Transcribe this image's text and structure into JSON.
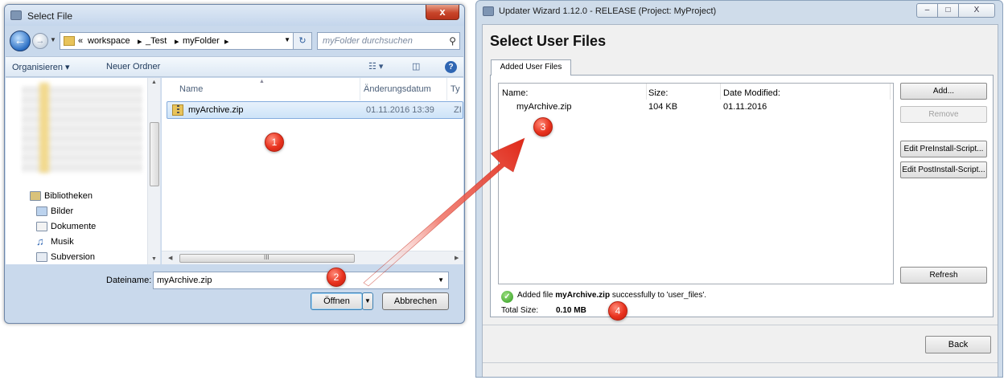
{
  "file_dialog": {
    "title": "Select File",
    "close_glyph": "x",
    "breadcrumb": [
      "«",
      "workspace",
      "▸",
      "_Test",
      "▸",
      "myFolder",
      "▸"
    ],
    "search_placeholder": "myFolder durchsuchen",
    "toolbar": {
      "organize": "Organisieren ▾",
      "new_folder": "Neuer Ordner"
    },
    "tree": [
      {
        "label": "Bibliotheken",
        "icon": "libraries-icon"
      },
      {
        "label": "Bilder",
        "icon": "pictures-icon"
      },
      {
        "label": "Dokumente",
        "icon": "documents-icon"
      },
      {
        "label": "Musik",
        "icon": "music-icon"
      },
      {
        "label": "Subversion",
        "icon": "subversion-icon"
      }
    ],
    "columns": {
      "name": "Name",
      "date": "Änderungsdatum",
      "type": "Ty"
    },
    "file": {
      "name": "myArchive.zip",
      "date": "01.11.2016 13:39",
      "type": "ZI"
    },
    "filename_label": "Dateiname:",
    "filename_value": "myArchive.zip",
    "open_label": "Öffnen",
    "cancel_label": "Abbrechen",
    "scroll_grip": "III"
  },
  "wizard": {
    "title": "Updater Wizard 1.12.0 - RELEASE (Project: MyProject)",
    "window_buttons": {
      "min": "–",
      "max": "□",
      "close": "X"
    },
    "heading": "Select User Files",
    "tab": "Added User Files",
    "columns": {
      "name": "Name:",
      "size": "Size:",
      "date": "Date Modified:"
    },
    "row": {
      "name": "myArchive.zip",
      "size": "104 KB",
      "date": "01.11.2016"
    },
    "buttons": {
      "add": "Add...",
      "remove": "Remove",
      "edit_pre": "Edit PreInstall-Script...",
      "edit_post": "Edit PostInstall-Script...",
      "refresh": "Refresh",
      "back": "Back"
    },
    "status": {
      "prefix": "Added file",
      "file": "myArchive.zip",
      "suffix": "successfully to 'user_files'."
    },
    "total_label": "Total Size:",
    "total_value": "0.10 MB"
  },
  "annotations": [
    "1",
    "2",
    "3",
    "4"
  ],
  "colors": {
    "badge": "#e8321e",
    "arrow": "#e02a1a",
    "title_bar": "#c9d9ec",
    "selection": "#cde3f8"
  }
}
